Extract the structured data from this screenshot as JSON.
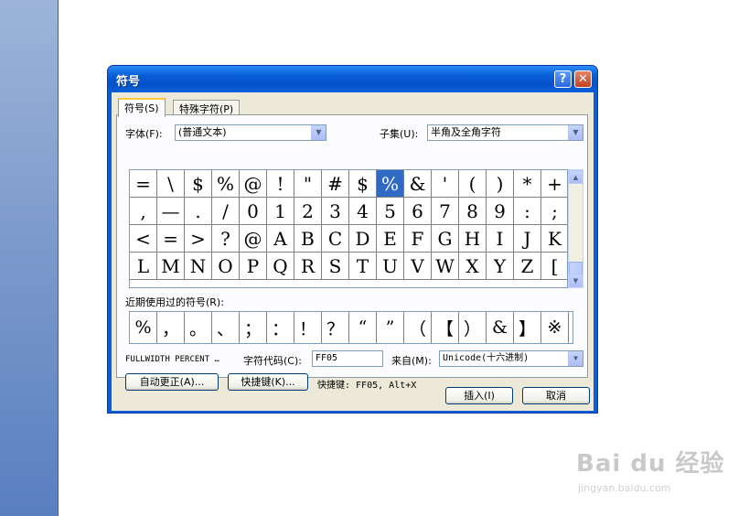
{
  "dialog": {
    "title": "符号",
    "help_label": "?",
    "close_label": "✕",
    "tabs": [
      {
        "label": "符号(S)"
      },
      {
        "label": "特殊字符(P)"
      }
    ],
    "font_label": "字体(F):",
    "font_value": "(普通文本)",
    "subset_label": "子集(U):",
    "subset_value": "半角及全角字符",
    "symbol_rows": [
      [
        "=",
        "\\",
        "$",
        "%",
        "@",
        "!",
        "\"",
        "#",
        "$",
        "%",
        "&",
        "'",
        "(",
        ")",
        "*",
        "+"
      ],
      [
        ",",
        "—",
        ".",
        "/",
        "0",
        "1",
        "2",
        "3",
        "4",
        "5",
        "6",
        "7",
        "8",
        "9",
        ":",
        ";"
      ],
      [
        "<",
        "=",
        ">",
        "?",
        "@",
        "A",
        "B",
        "C",
        "D",
        "E",
        "F",
        "G",
        "H",
        "I",
        "J",
        "K"
      ],
      [
        "L",
        "M",
        "N",
        "O",
        "P",
        "Q",
        "R",
        "S",
        "T",
        "U",
        "V",
        "W",
        "X",
        "Y",
        "Z",
        "["
      ]
    ],
    "recent_label": "近期使用过的符号(R):",
    "recent_symbols": [
      "%",
      "，",
      "。",
      "、",
      "；",
      "：",
      "！",
      "？",
      "“",
      "”",
      "（",
      "【",
      "）",
      "&",
      "】",
      "※"
    ],
    "char_name": "FULLWIDTH PERCENT …",
    "char_code_label": "字符代码(C):",
    "char_code_value": "FF05",
    "from_label": "来自(M):",
    "from_value": "Unicode(十六进制)",
    "autocorrect_button": "自动更正(A)...",
    "shortcut_button": "快捷键(K)...",
    "shortcut_info": "快捷键: FF05, Alt+X",
    "insert_button": "插入(I)",
    "cancel_button": "取消"
  },
  "watermark": {
    "logo_text": "Bai du 经验",
    "url": "jingyan.baidu.com"
  }
}
